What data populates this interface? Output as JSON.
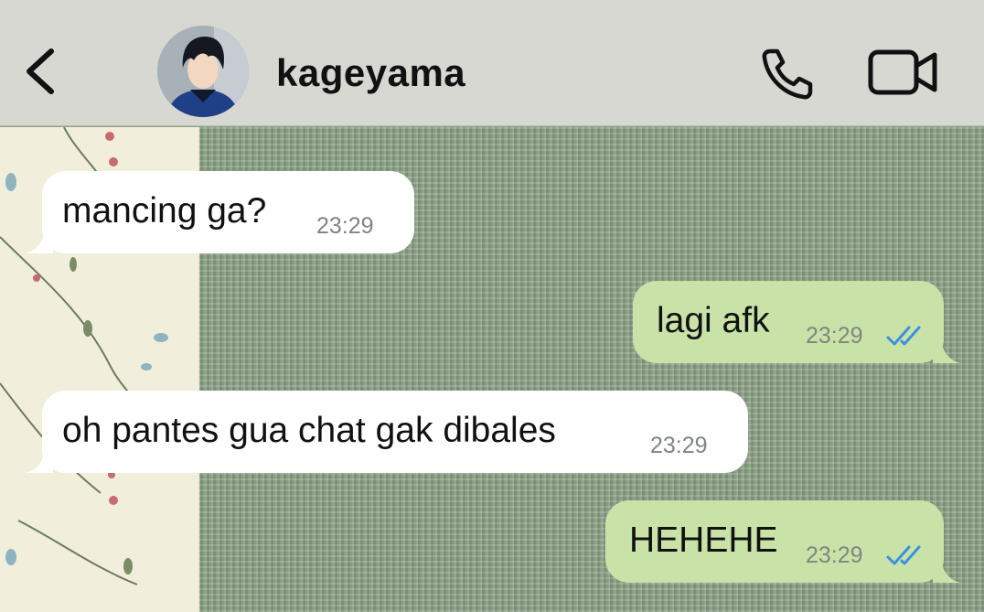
{
  "header": {
    "contact_name": "kageyama",
    "back_icon": "chevron-left-icon",
    "call_icon": "phone-icon",
    "video_icon": "video-camera-icon"
  },
  "messages": [
    {
      "direction": "incoming",
      "text": "mancing ga?",
      "time": "23:29"
    },
    {
      "direction": "outgoing",
      "text": "lagi afk",
      "time": "23:29",
      "status": "read"
    },
    {
      "direction": "incoming",
      "text": "oh pantes gua chat gak dibales",
      "time": "23:29"
    },
    {
      "direction": "outgoing",
      "text": "HEHEHE",
      "time": "23:29",
      "status": "read"
    }
  ],
  "colors": {
    "header_bg": "#d7d8d2",
    "incoming_bubble": "#ffffff",
    "outgoing_bubble": "#c9e2a8",
    "read_check": "#3d8fe0",
    "wallpaper_green": "#8aa084",
    "wallpaper_floral": "#f1efdc"
  }
}
